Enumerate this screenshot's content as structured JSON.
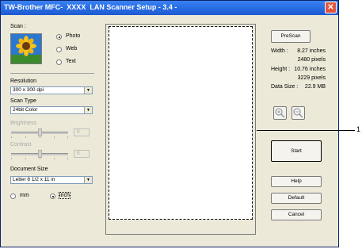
{
  "window": {
    "title": "TW-Brother MFC-  XXXX  LAN Scanner Setup - 3.4 -",
    "close_glyph": "✕"
  },
  "scan": {
    "label": "Scan :",
    "options": [
      "Photo",
      "Web",
      "Text"
    ],
    "selected": "Photo"
  },
  "resolution": {
    "label": "Resolution",
    "value": "300 x 300 dpi"
  },
  "scan_type": {
    "label": "Scan Type",
    "value": "24bit Color"
  },
  "brightness": {
    "label": "Brightness",
    "value": "0",
    "level": 0.5
  },
  "contrast": {
    "label": "Contrast",
    "value": "0",
    "level": 0.5
  },
  "document_size": {
    "label": "Document Size",
    "value": "Letter 8 1/2 x 11 in"
  },
  "units": {
    "options": [
      "mm",
      "inch"
    ],
    "selected": "inch"
  },
  "buttons": {
    "prescan": "PreScan",
    "start": "Start",
    "help": "Help",
    "default": "Default",
    "cancel": "Cancel"
  },
  "info": {
    "width_label": "Width :",
    "width_inches": "8.27 inches",
    "width_pixels": "2480 pixels",
    "height_label": "Height :",
    "height_inches": "10.76 inches",
    "height_pixels": "3229 pixels",
    "data_size_label": "Data Size :",
    "data_size": "22.9 MB"
  },
  "callout": {
    "number": "1"
  },
  "icons": [
    "sunflower-photo-icon",
    "zoom-in-icon",
    "zoom-out-icon",
    "close-icon"
  ]
}
